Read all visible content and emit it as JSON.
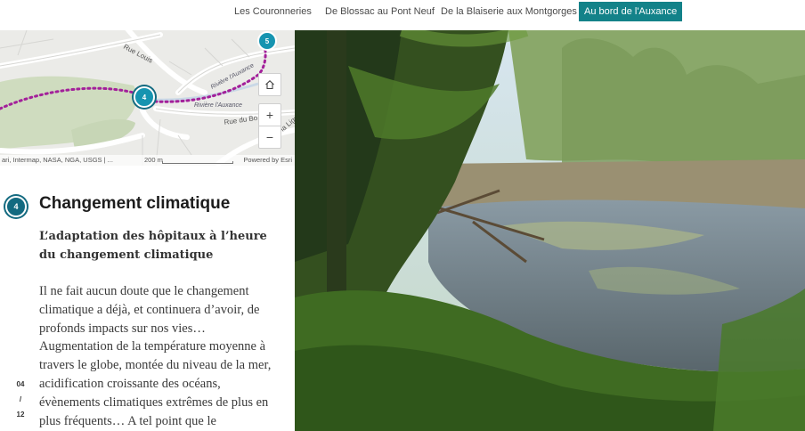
{
  "nav": {
    "tabs": [
      {
        "label": "Les Couronneries",
        "active": false
      },
      {
        "label": "De Blossac au Pont Neuf",
        "active": false
      },
      {
        "label": "De la Blaiserie aux Montgorges",
        "active": false
      },
      {
        "label": "Au bord de l'Auxance",
        "active": true
      }
    ]
  },
  "map": {
    "street_labels": [
      "Rue Louis",
      "Rivière l'Auxance",
      "Rivière l'Auxance",
      "Rue du Bo",
      "Rue de la Ligugé"
    ],
    "markers": [
      "4",
      "5"
    ],
    "attribution": "ari, Intermap, NASA, NGA, USGS | ...",
    "scale_label": "200 m",
    "powered_by": "Powered by Esri",
    "route_color": "#a3209a",
    "marker_color": "#1694b0"
  },
  "story": {
    "badge": "4",
    "title": "Changement climatique",
    "subtitle": "L’adaptation des hôpitaux à l’heure du changement climatique",
    "body": "Il ne fait aucun doute que le changement climatique a déjà, et continuera d’avoir, de profonds impacts sur nos vies… Augmentation de la température moyenne à travers le globe, montée du niveau de la mer, acidification croissante des océans, évènements climatiques extrêmes de plus en plus fréquents… A tel point que le",
    "counter": {
      "current": "04",
      "sep": "/",
      "total": "12"
    }
  },
  "theme": {
    "accent": "#138289",
    "badge": "#136a80"
  }
}
